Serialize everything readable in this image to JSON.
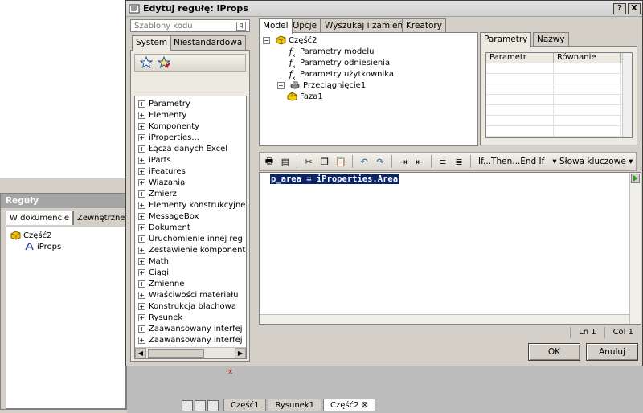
{
  "dialog": {
    "title": "Edytuj regułę: iProps",
    "help_label": "?",
    "close_label": "X",
    "snippets": {
      "header": "Szablony kodu",
      "tabs": [
        "System",
        "Niestandardowa"
      ],
      "items": [
        "Parametry",
        "Elementy",
        "Komponenty",
        "iProperties...",
        "Łącza danych Excel",
        "iParts",
        "iFeatures",
        "Wiązania",
        "Zmierz",
        "Elementy konstrukcyjne",
        "MessageBox",
        "Dokument",
        "Uruchomienie innej reg",
        "Zestawienie komponent",
        "Math",
        "Ciągi",
        "Zmienne",
        "Właściwości materiału",
        "Konstrukcja blachowa",
        "Rysunek",
        "Zaawansowany interfej",
        "Zaawansowany interfej"
      ]
    },
    "model_tabs": [
      "Model",
      "Opcje",
      "Wyszukaj i zamień",
      "Kreatory"
    ],
    "model_tree": {
      "root": "Część2",
      "children": [
        "Parametry modelu",
        "Parametry odniesienia",
        "Parametry użytkownika",
        "Przeciągnięcie1",
        "Faza1"
      ]
    },
    "param_tabs": [
      "Parametry",
      "Nazwy"
    ],
    "param_columns": [
      "Parametr",
      "Równanie"
    ],
    "toolbar": {
      "if_then": "If...Then...End If",
      "keywords": "Słowa kluczowe"
    },
    "code": "p_area = iProperties.Area",
    "status": {
      "line": "Ln 1",
      "col": "Col 1"
    },
    "ok_label": "OK",
    "cancel_label": "Anuluj"
  },
  "background": {
    "rules_title": "Reguły",
    "rules_tabs": [
      "W dokumencie",
      "Zewnętrzne"
    ],
    "tree_root": "Część2",
    "tree_child": "iProps",
    "bottom_tabs": [
      "Część1",
      "Rysunek1",
      "Część2"
    ]
  },
  "colors": {
    "selection": "#0a246a",
    "folder_yellow": "#f5c400"
  }
}
